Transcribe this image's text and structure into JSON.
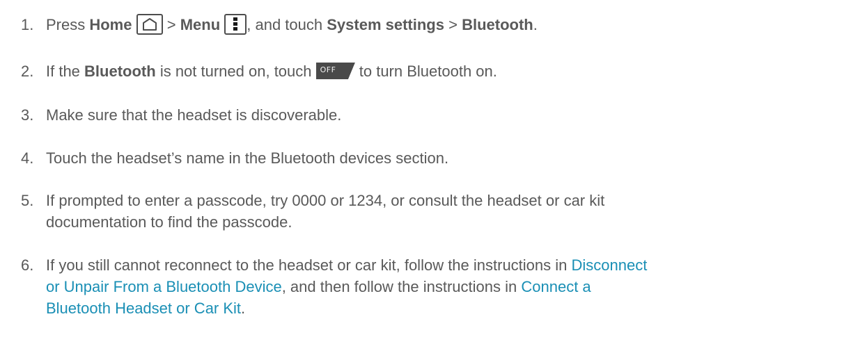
{
  "steps": [
    {
      "num": "1.",
      "parts": {
        "a": "Press ",
        "home": "Home",
        "b": " > ",
        "menu": "Menu",
        "c": ", and touch ",
        "system_settings": "System settings",
        "d": " > ",
        "bluetooth": "Bluetooth",
        "e": "."
      },
      "icons": {
        "home": "home-icon",
        "menu": "menu-icon"
      }
    },
    {
      "num": "2.",
      "parts": {
        "a": "If the ",
        "bluetooth": "Bluetooth",
        "b": " is not turned on, touch ",
        "c": " to turn Bluetooth on."
      },
      "toggle": {
        "label": "OFF",
        "icon": "off-toggle-icon"
      }
    },
    {
      "num": "3.",
      "text": "Make sure that the headset is discoverable."
    },
    {
      "num": "4.",
      "text": "Touch the headset’s name in the Bluetooth devices section."
    },
    {
      "num": "5.",
      "line1": "If prompted to enter a passcode, try 0000 or 1234, or consult the headset or car kit",
      "line2": "documentation to find the passcode."
    },
    {
      "num": "6.",
      "parts": {
        "a": "If you still cannot reconnect to the headset or car kit, follow the instructions in ",
        "link1a": "Disconnect",
        "link1b": "or Unpair From a Bluetooth Device",
        "b": ", and then follow the instructions in ",
        "link2a": "Connect a",
        "link2b": "Bluetooth Headset or Car Kit",
        "c": "."
      }
    }
  ],
  "colors": {
    "text": "#595959",
    "link": "#1a8fb5",
    "toggle_bg": "#4a4a4a"
  }
}
